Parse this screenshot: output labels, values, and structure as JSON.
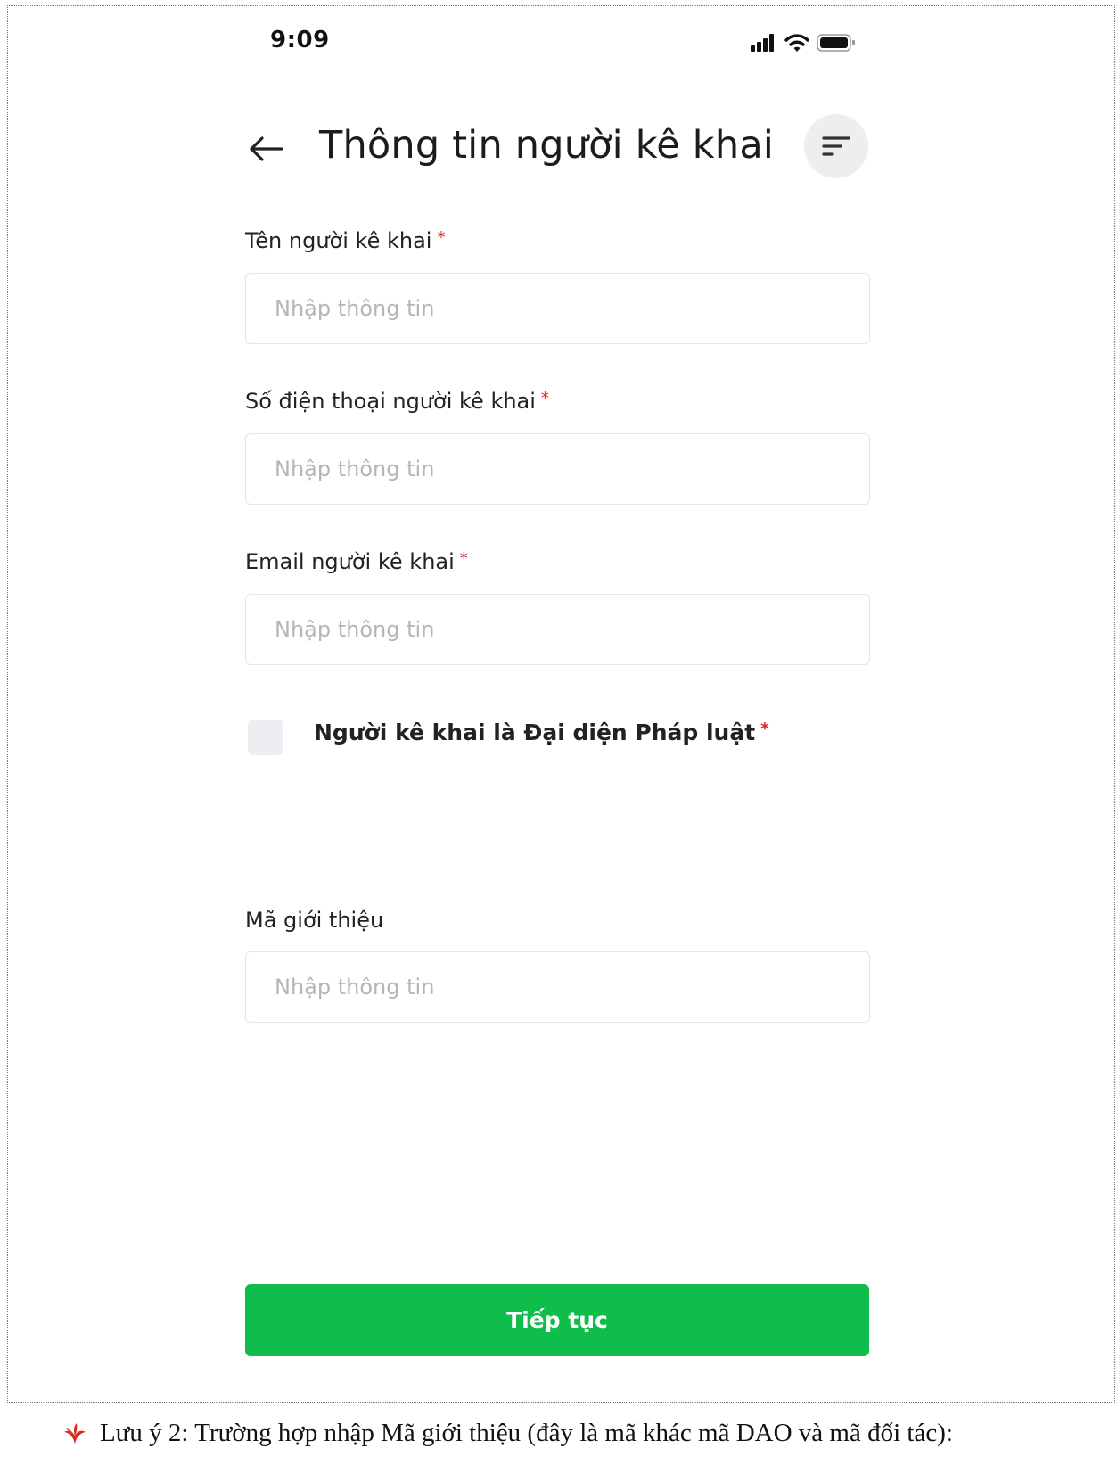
{
  "status_bar": {
    "time": "9:09",
    "icons": [
      "signal-icon",
      "wifi-icon",
      "battery-icon"
    ]
  },
  "header": {
    "back_icon": "arrow-left-icon",
    "title": "Thông tin người kê khai",
    "menu_icon": "filter-lines-icon"
  },
  "form": {
    "fields": [
      {
        "label": "Tên người kê khai",
        "required_mark": "*",
        "value": "",
        "placeholder": "Nhập thông tin"
      },
      {
        "label": "Số điện thoại người kê khai",
        "required_mark": "*",
        "value": "",
        "placeholder": "Nhập thông tin"
      },
      {
        "label": "Email người kê khai",
        "required_mark": "*",
        "value": "",
        "placeholder": "Nhập thông tin"
      }
    ],
    "legal_rep_checkbox": {
      "label": "Người kê khai là Đại diện Pháp luật",
      "required_mark": "*",
      "checked": false
    },
    "referral": {
      "label": "Mã giới thiệu",
      "value": "",
      "placeholder": "Nhập thông tin"
    }
  },
  "continue_button": {
    "label": "Tiếp tục"
  },
  "colors": {
    "accent": "#0ebd4a",
    "required": "#e02020",
    "placeholder": "#b5b5b5"
  },
  "note": {
    "icon": "red-leaf-bullet-icon",
    "text": "Lưu ý 2: Trường hợp nhập Mã giới thiệu (đây là mã khác mã DAO và mã đối tác):"
  }
}
